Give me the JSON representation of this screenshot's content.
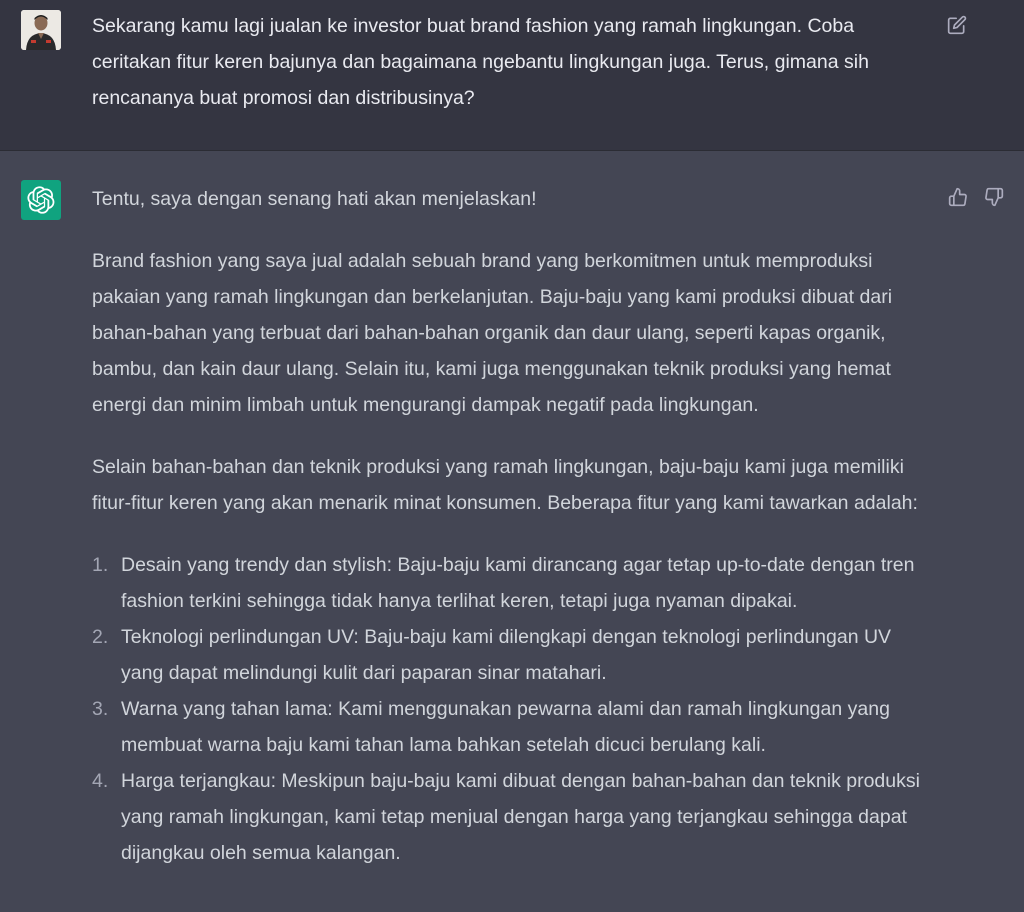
{
  "user_message": {
    "text": "Sekarang kamu lagi jualan ke investor buat brand fashion yang ramah lingkungan. Coba ceritakan fitur keren bajunya dan bagaimana ngebantu lingkungan juga. Terus, gimana sih rencananya buat promosi dan distribusinya?",
    "avatar_icon": "user-photo-icon",
    "edit_icon": "edit-icon"
  },
  "assistant_message": {
    "avatar_icon": "openai-logo-icon",
    "intro": "Tentu, saya dengan senang hati akan menjelaskan!",
    "paragraph_1": "Brand fashion yang saya jual adalah sebuah brand yang berkomitmen untuk memproduksi pakaian yang ramah lingkungan dan berkelanjutan. Baju-baju yang kami produksi dibuat dari bahan-bahan yang terbuat dari bahan-bahan organik dan daur ulang, seperti kapas organik, bambu, dan kain daur ulang. Selain itu, kami juga menggunakan teknik produksi yang hemat energi dan minim limbah untuk mengurangi dampak negatif pada lingkungan.",
    "paragraph_2": "Selain bahan-bahan dan teknik produksi yang ramah lingkungan, baju-baju kami juga memiliki fitur-fitur keren yang akan menarik minat konsumen. Beberapa fitur yang kami tawarkan adalah:",
    "features": [
      {
        "num": "1.",
        "text": "Desain yang trendy dan stylish: Baju-baju kami dirancang agar tetap up-to-date dengan tren fashion terkini sehingga tidak hanya terlihat keren, tetapi juga nyaman dipakai."
      },
      {
        "num": "2.",
        "text": "Teknologi perlindungan UV: Baju-baju kami dilengkapi dengan teknologi perlindungan UV yang dapat melindungi kulit dari paparan sinar matahari."
      },
      {
        "num": "3.",
        "text": "Warna yang tahan lama: Kami menggunakan pewarna alami dan ramah lingkungan yang membuat warna baju kami tahan lama bahkan setelah dicuci berulang kali."
      },
      {
        "num": "4.",
        "text": "Harga terjangkau: Meskipun baju-baju kami dibuat dengan bahan-bahan dan teknik produksi yang ramah lingkungan, kami tetap menjual dengan harga yang terjangkau sehingga dapat dijangkau oleh semua kalangan."
      }
    ],
    "thumbs_up_icon": "thumbs-up-icon",
    "thumbs_down_icon": "thumbs-down-icon"
  },
  "colors": {
    "user_bg": "#343541",
    "assistant_bg": "#444654",
    "bot_avatar": "#10a37f",
    "text": "#d1d5db"
  }
}
